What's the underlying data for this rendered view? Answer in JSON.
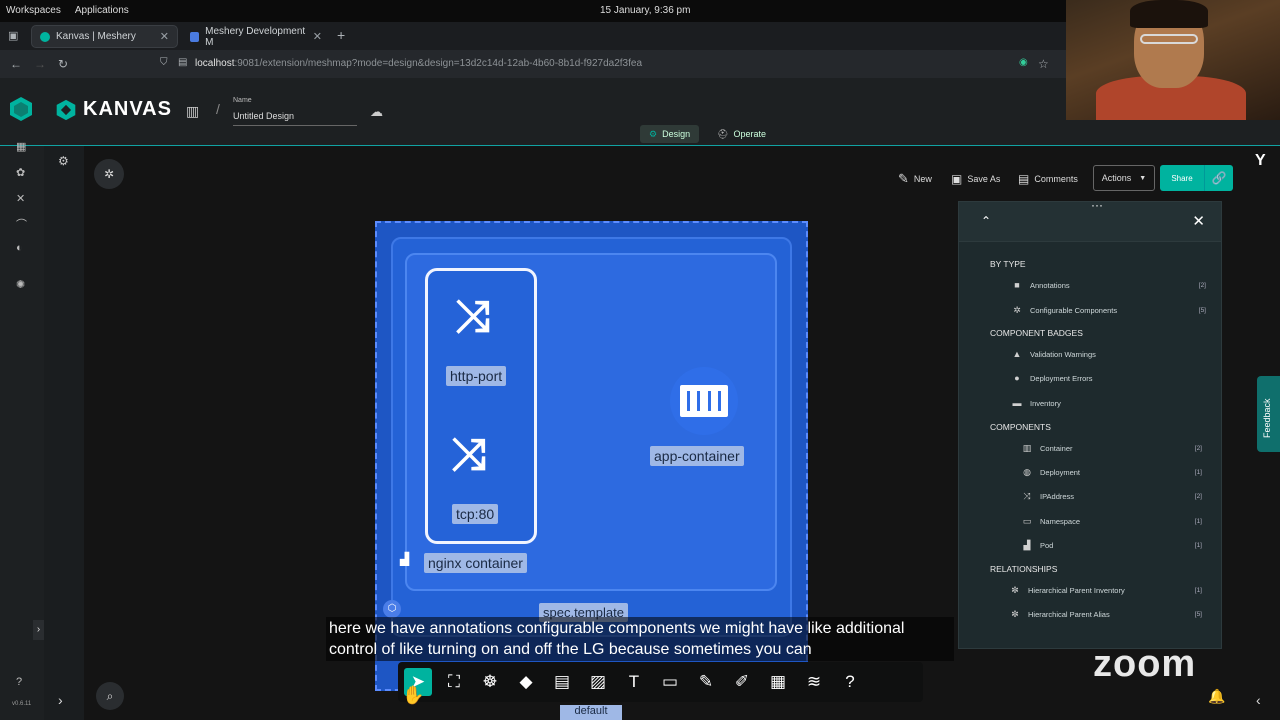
{
  "os": {
    "menu": [
      "Workspaces",
      "Applications"
    ],
    "clock": "15 January, 9:36 pm"
  },
  "browser": {
    "tabs": [
      {
        "title": "Kanvas | Meshery",
        "active": true
      },
      {
        "title": "Meshery Development M",
        "active": false
      }
    ],
    "url_host": "localhost",
    "url_rest": ":9081/extension/meshmap?mode=design&design=13d2c14d-12ab-4b60-8b1d-f927da2f3fea"
  },
  "header": {
    "brand": "KANVAS",
    "name_label": "Name",
    "design_name": "Untitled Design",
    "modes": [
      "Design",
      "Operate"
    ]
  },
  "toolbar": {
    "new_label": "New",
    "save_as_label": "Save As",
    "comments_label": "Comments",
    "actions_label": "Actions",
    "share_label": "Share"
  },
  "canvas": {
    "nodes": {
      "http_port": "http-port",
      "tcp": "tcp:80",
      "nginx": "nginx container",
      "app_container": "app-container",
      "spec_template": "spec.template",
      "bottom_tag": "default"
    }
  },
  "caption": "here we have annotations configurable components we might have like additional control of like turning on and off the LG because sometimes you can",
  "panel": {
    "sections": [
      {
        "title": "BY TYPE",
        "items": [
          {
            "label": "Annotations",
            "count": "[2]",
            "icon": "square-icon"
          },
          {
            "label": "Configurable Components",
            "count": "[5]",
            "icon": "gears-icon"
          }
        ]
      },
      {
        "title": "COMPONENT BADGES",
        "items": [
          {
            "label": "Validation Warnings",
            "count": "",
            "icon": "warning-icon"
          },
          {
            "label": "Deployment Errors",
            "count": "",
            "icon": "circle-icon"
          },
          {
            "label": "Inventory",
            "count": "",
            "icon": "inventory-icon"
          }
        ]
      },
      {
        "title": "COMPONENTS",
        "items": [
          {
            "label": "Container",
            "count": "[2]",
            "icon": "container-icon"
          },
          {
            "label": "Deployment",
            "count": "[1]",
            "icon": "deployment-icon"
          },
          {
            "label": "IPAddress",
            "count": "[2]",
            "icon": "shuffle-icon"
          },
          {
            "label": "Namespace",
            "count": "[1]",
            "icon": "namespace-icon"
          },
          {
            "label": "Pod",
            "count": "[1]",
            "icon": "pod-icon"
          }
        ]
      },
      {
        "title": "RELATIONSHIPS",
        "items": [
          {
            "label": "Hierarchical Parent Inventory",
            "count": "[1]",
            "icon": "relationship-icon"
          },
          {
            "label": "Hierarchical Parent Alias",
            "count": "[5]",
            "icon": "relationship-icon"
          }
        ]
      }
    ]
  },
  "feedback_label": "Feedback",
  "version": "v0.6.11",
  "zoom_watermark": "zoom",
  "colors": {
    "accent": "#00b39f",
    "canvas_blue": "#2462d6"
  }
}
